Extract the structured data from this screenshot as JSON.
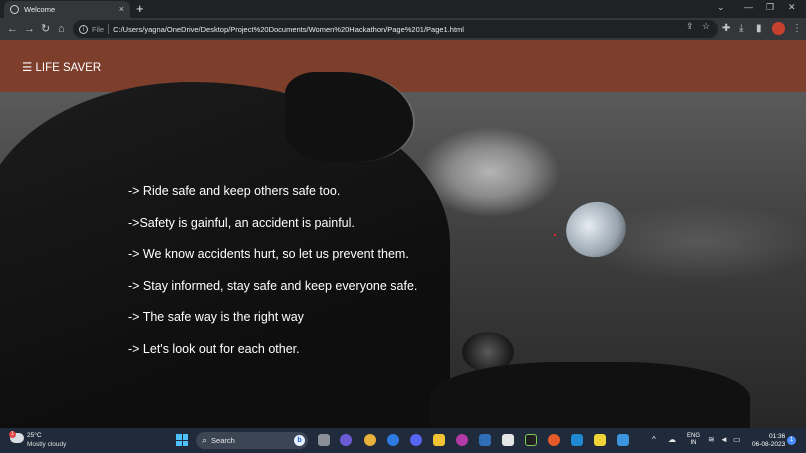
{
  "browser": {
    "tab_title": "Welcome",
    "tab_close": "×",
    "new_tab": "+",
    "address_prefix": "File",
    "url": "C:/Users/yagna/OneDrive/Desktop/Project%20Documents/Women%20Hackathon/Page%201/Page1.html",
    "icons": [
      "back-icon",
      "forward-icon",
      "reload-icon",
      "home-icon",
      "info-icon",
      "share-icon",
      "star-icon",
      "extensions-icon",
      "download-icon",
      "sidebar-icon",
      "menu-icon"
    ]
  },
  "site": {
    "brand": "☰ LIFE SAVER",
    "slogans": [
      "-> Ride safe and keep others safe too.",
      "->Safety is gainful, an accident is painful.",
      "-> We know accidents hurt, so let us prevent them.",
      "-> Stay informed, stay safe and keep everyone safe.",
      "-> The safe way is the right way",
      "-> Let's look out for each other."
    ],
    "colors": {
      "navbar": "#7d3e2b",
      "text": "#ffffff"
    }
  },
  "taskbar": {
    "weather_badge": "1",
    "temperature": "25°C",
    "condition": "Mostly cloudy",
    "search_label": "Search",
    "bing_label": "b",
    "language": "ENG",
    "region": "IN",
    "time": "01:36",
    "date": "06-08-2023",
    "notification_count": "1"
  }
}
